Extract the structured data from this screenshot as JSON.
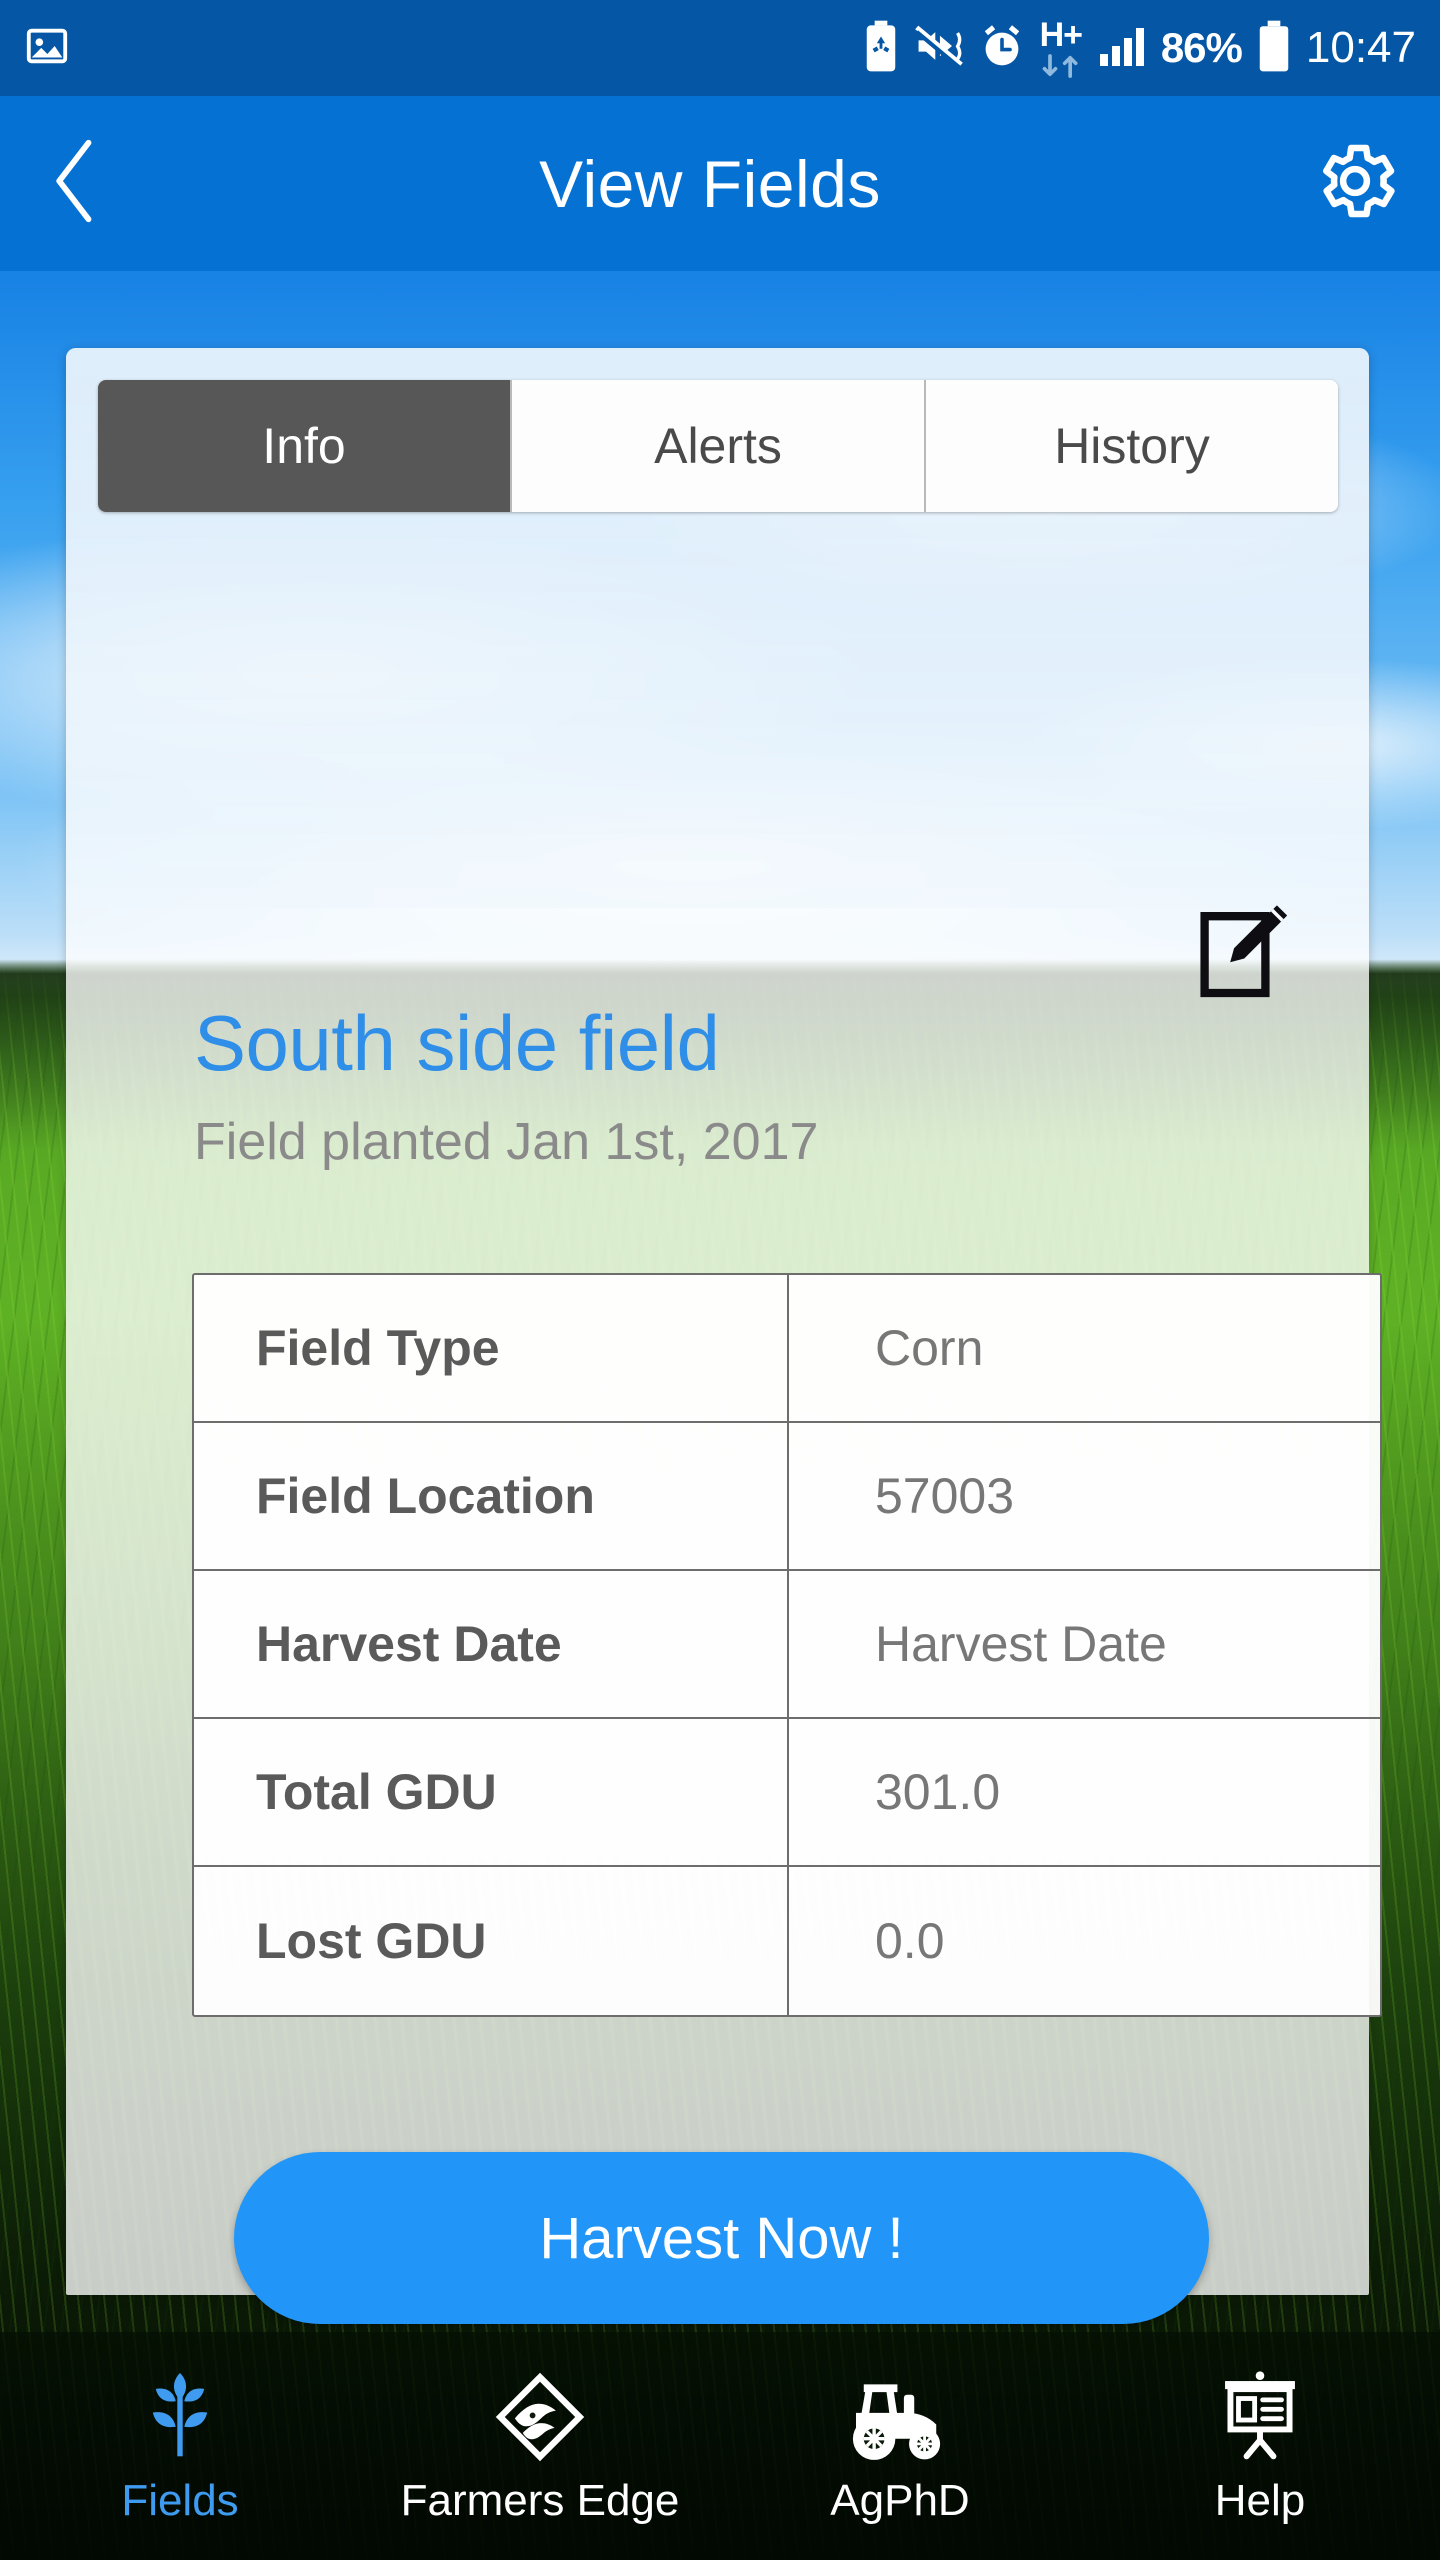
{
  "status_bar": {
    "icons": [
      "gallery-icon",
      "battery-saver-icon",
      "vibrate-mute-icon",
      "alarm-clock-icon",
      "hplus-data-icon",
      "signal-bars-icon"
    ],
    "network_type": "H+",
    "battery_percent": "86%",
    "clock": "10:47"
  },
  "app_bar": {
    "back_icon": "chevron-left-icon",
    "title": "View Fields",
    "settings_icon": "gear-icon",
    "background_color": "#0571d3"
  },
  "tabs": [
    {
      "label": "Info",
      "active": true
    },
    {
      "label": "Alerts",
      "active": false
    },
    {
      "label": "History",
      "active": false
    }
  ],
  "field": {
    "edit_icon": "edit-pencil-icon",
    "name": "South side field",
    "planted_text": "Field planted Jan 1st, 2017",
    "name_color": "#2f8ee8"
  },
  "details_table": {
    "rows": [
      {
        "key": "Field Type",
        "value": "Corn"
      },
      {
        "key": "Field Location",
        "value": "57003"
      },
      {
        "key": "Harvest Date",
        "value": "Harvest Date"
      },
      {
        "key": "Total GDU",
        "value": "301.0"
      },
      {
        "key": "Lost GDU",
        "value": "0.0"
      }
    ]
  },
  "actions": {
    "harvest_label": "Harvest Now !",
    "harvest_color": "#2196f8"
  },
  "bottom_nav": [
    {
      "label": "Fields",
      "icon": "wheat-plant-icon",
      "active": true
    },
    {
      "label": "Farmers Edge",
      "icon": "farmers-edge-logo-icon",
      "active": false
    },
    {
      "label": "AgPhD",
      "icon": "tractor-icon",
      "active": false
    },
    {
      "label": "Help",
      "icon": "presentation-board-icon",
      "active": false
    }
  ]
}
